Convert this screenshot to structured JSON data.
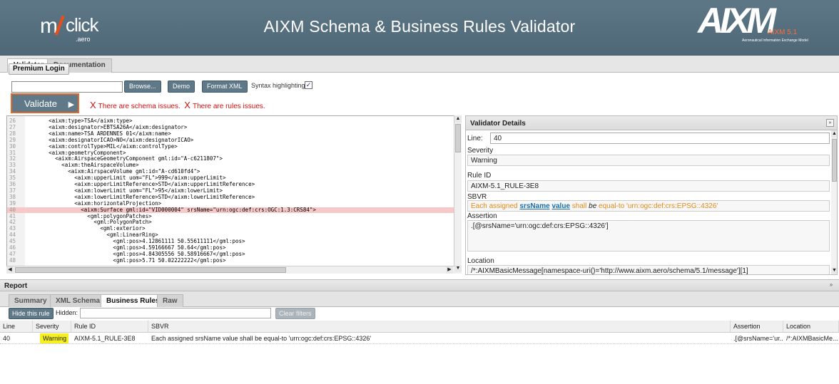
{
  "header": {
    "logo_left_m": "m",
    "logo_left_click": "click",
    "logo_left_aero": ".aero",
    "title": "AIXM Schema & Business Rules Validator",
    "logo_right_main": "AIXM",
    "logo_right_version": "AIXM 5.1",
    "logo_right_sub": "Aeronautical Information Exchange Model"
  },
  "main_tabs": [
    "Validator",
    "Documentation"
  ],
  "toolbar": {
    "premium_login": "Premium Login",
    "file_path": "",
    "browse": "Browse...",
    "demo": "Demo",
    "format_xml": "Format XML",
    "syntax_highlighting": "Syntax highlighting:",
    "syntax_checked": "✓",
    "validate": "Validate",
    "validate_arrow": "▶",
    "schema_issue": "There are schema issues.",
    "rules_issue": "There are rules issues.",
    "issue_mark": "X"
  },
  "editor": {
    "lines": [
      {
        "num": "26",
        "text": "        <aixm:type>TSA</aixm:type>"
      },
      {
        "num": "27",
        "text": "        <aixm:designator>EBTSA26A</aixm:designator>"
      },
      {
        "num": "28",
        "text": "        <aixm:name>TSA ARDENNES 01</aixm:name>"
      },
      {
        "num": "29",
        "text": "        <aixm:designatorICAO>NO</aixm:designatorICAO>"
      },
      {
        "num": "30",
        "text": "        <aixm:controlType>MIL</aixm:controlType>"
      },
      {
        "num": "31",
        "text": "        <aixm:geometryComponent>"
      },
      {
        "num": "32",
        "text": "          <aixm:AirspaceGeometryComponent gml:id=\"A-c6211807\">"
      },
      {
        "num": "33",
        "text": "            <aixm:theAirspaceVolume>"
      },
      {
        "num": "34",
        "text": "              <aixm:AirspaceVolume gml:id=\"A-cd610fd4\">"
      },
      {
        "num": "35",
        "text": "                <aixm:upperLimit uom=\"FL\">999</aixm:upperLimit>"
      },
      {
        "num": "36",
        "text": "                <aixm:upperLimitReference>STD</aixm:upperLimitReference>"
      },
      {
        "num": "37",
        "text": "                <aixm:lowerLimit uom=\"FL\">95</aixm:lowerLimit>"
      },
      {
        "num": "38",
        "text": "                <aixm:lowerLimitReference>STD</aixm:lowerLimitReference>"
      },
      {
        "num": "39",
        "text": "                <aixm:horizontalProjection>"
      },
      {
        "num": "40",
        "text": "                  <aixm:Surface gml:id=\"VID000004\" srsName=\"urn:ogc:def:crs:OGC:1.3:CRS84\">"
      },
      {
        "num": "41",
        "text": "                    <gml:polygonPatches>"
      },
      {
        "num": "42",
        "text": "                      <gml:PolygonPatch>"
      },
      {
        "num": "43",
        "text": "                        <gml:exterior>"
      },
      {
        "num": "44",
        "text": "                          <gml:LinearRing>"
      },
      {
        "num": "45",
        "text": "                            <gml:pos>4.12861111 50.55611111</gml:pos>"
      },
      {
        "num": "46",
        "text": "                            <gml:pos>4.59166667 50.64</gml:pos>"
      },
      {
        "num": "47",
        "text": "                            <gml:pos>4.84305556 50.58916667</gml:pos>"
      },
      {
        "num": "48",
        "text": "                            <gml:pos>5.71 50.02222222</gml:pos>"
      }
    ]
  },
  "details": {
    "title": "Validator Details",
    "collapse_icon": "»",
    "line_label": "Line:",
    "line_value": "40",
    "severity_label": "Severity",
    "severity_value": "Warning",
    "rule_id_label": "Rule ID",
    "rule_id_value": "AIXM-5.1_RULE-3E8",
    "sbvr_label": "SBVR",
    "sbvr_parts": {
      "p1": "Each assigned ",
      "k1": "srsName",
      "k2": "value",
      "p2": " shall ",
      "i1": "be",
      "p3": " equal-to 'urn:ogc:def:crs:EPSG::4326'"
    },
    "assertion_label": "Assertion",
    "assertion_value": ".[@srsName='urn:ogc:def:crs:EPSG::4326']",
    "location_label": "Location",
    "location_value": "/*:AIXMBasicMessage[namespace-uri()='http://www.aixm.aero/schema/5.1/message'][1]"
  },
  "report": {
    "title": "Report",
    "collapse_icon": "»",
    "tabs": [
      "Summary",
      "XML Schema",
      "Business Rules",
      "Raw"
    ],
    "hide_rule": "Hide this rule",
    "hidden_label": "Hidden:",
    "clear_filters": "Clear filters",
    "columns": [
      "Line",
      "Severity",
      "Rule ID",
      "SBVR",
      "Assertion",
      "Location"
    ],
    "rows": [
      {
        "line": "40",
        "severity": "Warning",
        "rule_id": "AIXM-5.1_RULE-3E8",
        "sbvr": "Each assigned srsName value shall be equal-to 'urn:ogc:def:crs:EPSG::4326'",
        "assertion": ".[@srsName='ur...",
        "location": "/*:AIXMBasicMe..."
      }
    ]
  },
  "colors": {
    "header_bg": "#55707f",
    "accent_orange": "#e06a2a",
    "error_red": "#cc1111",
    "highlight_line": "#f7c8c8",
    "warning_badge": "#f7f01f"
  }
}
